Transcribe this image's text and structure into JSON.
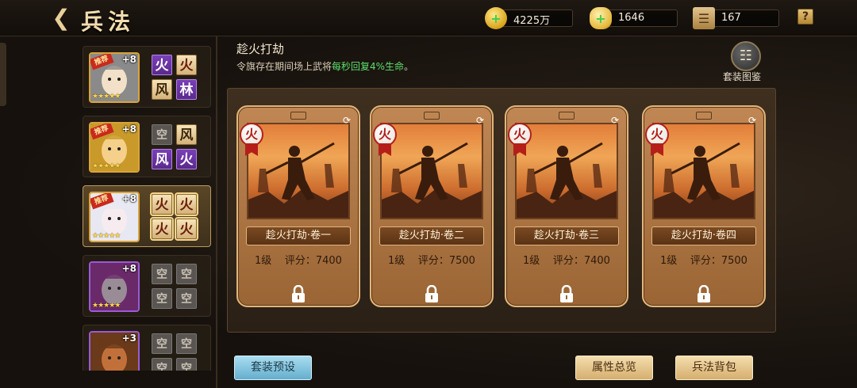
{
  "header": {
    "title": "兵法",
    "resources": [
      {
        "icon": "gold-coin-icon",
        "value": "4225万"
      },
      {
        "icon": "gold-ingot-icon",
        "value": "1646"
      },
      {
        "icon": "scroll-icon",
        "value": "167"
      }
    ],
    "help": "?"
  },
  "generals": [
    {
      "plus": "+8",
      "recommend": "推荐",
      "quality": "gold",
      "tiles": [
        {
          "char": "火",
          "style": "purple"
        },
        {
          "char": "火",
          "style": "fire"
        },
        {
          "char": "风",
          "style": "wind"
        },
        {
          "char": "林",
          "style": "purple"
        }
      ]
    },
    {
      "plus": "+8",
      "recommend": "推荐",
      "quality": "gold",
      "tiles": [
        {
          "char": "空",
          "style": "empty"
        },
        {
          "char": "风",
          "style": "wind"
        },
        {
          "char": "风",
          "style": "purple"
        },
        {
          "char": "火",
          "style": "purple"
        }
      ]
    },
    {
      "plus": "+8",
      "recommend": "推荐",
      "quality": "gold",
      "active": true,
      "tiles": [
        {
          "char": "火",
          "style": "fire"
        },
        {
          "char": "火",
          "style": "fire"
        },
        {
          "char": "火",
          "style": "fire"
        },
        {
          "char": "火",
          "style": "fire"
        }
      ]
    },
    {
      "plus": "+8",
      "recommend": "",
      "quality": "purple",
      "tiles": [
        {
          "char": "空",
          "style": "empty"
        },
        {
          "char": "空",
          "style": "empty"
        },
        {
          "char": "空",
          "style": "empty"
        },
        {
          "char": "空",
          "style": "empty"
        }
      ]
    },
    {
      "plus": "+3",
      "recommend": "",
      "quality": "purple",
      "tiles": [
        {
          "char": "空",
          "style": "empty"
        },
        {
          "char": "空",
          "style": "empty"
        },
        {
          "char": "空",
          "style": "empty"
        },
        {
          "char": "空",
          "style": "empty"
        }
      ]
    }
  ],
  "set": {
    "name": "趁火打劫",
    "desc_prefix": "令旗存在期间场上武将",
    "desc_highlight": "每秒回复4%生命",
    "desc_suffix": "。",
    "guide_label": "套装图鉴"
  },
  "cards": [
    {
      "element": "火",
      "name": "趁火打劫·卷一",
      "level": "1级",
      "score_label": "评分：",
      "score": "7400"
    },
    {
      "element": "火",
      "name": "趁火打劫·卷二",
      "level": "1级",
      "score_label": "评分：",
      "score": "7500"
    },
    {
      "element": "火",
      "name": "趁火打劫·卷三",
      "level": "1级",
      "score_label": "评分：",
      "score": "7400"
    },
    {
      "element": "火",
      "name": "趁火打劫·卷四",
      "level": "1级",
      "score_label": "评分：",
      "score": "7500"
    }
  ],
  "buttons": {
    "preset": "套装预设",
    "overview": "属性总览",
    "bag": "兵法背包"
  },
  "colors": {
    "highlight_green": "#5be06a",
    "fire_red": "#b41f1a",
    "preset_blue": "#64aecd"
  }
}
